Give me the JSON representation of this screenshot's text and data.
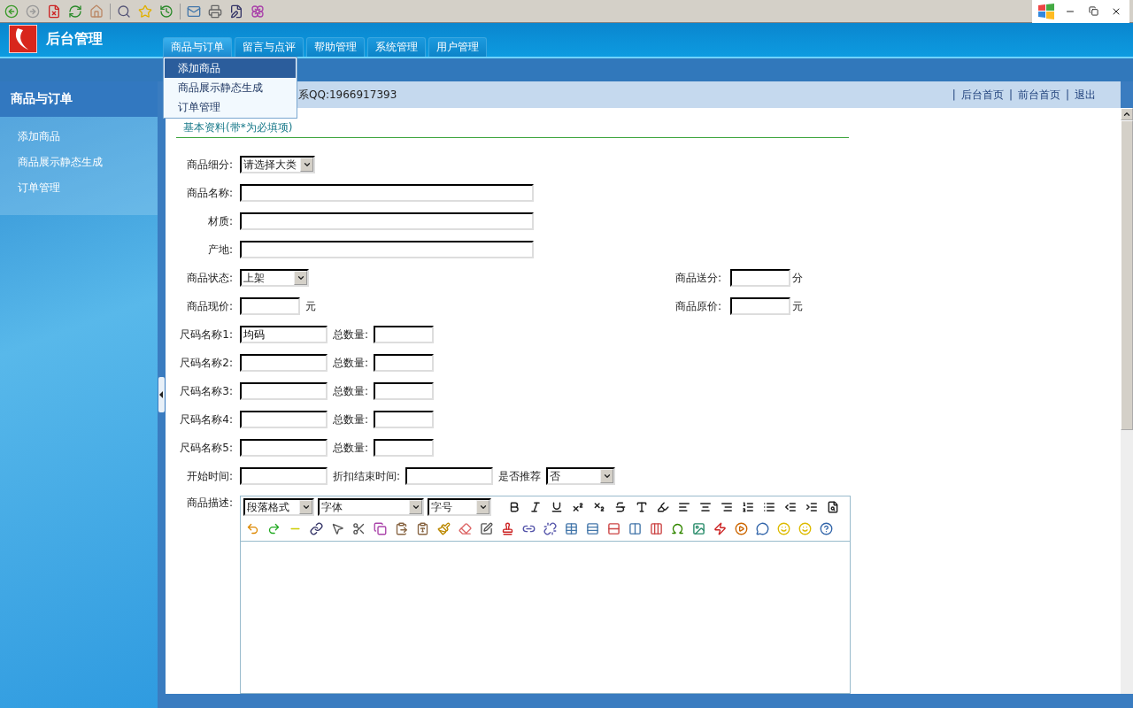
{
  "header": {
    "title": "后台管理",
    "tabs": [
      {
        "label": "商品与订单",
        "selected": true
      },
      {
        "label": "留言与点评",
        "selected": false
      },
      {
        "label": "帮助管理",
        "selected": false
      },
      {
        "label": "系统管理",
        "selected": false
      },
      {
        "label": "用户管理",
        "selected": false
      }
    ],
    "dropdown": [
      {
        "label": "添加商品",
        "selected": true
      },
      {
        "label": "商品展示静态生成",
        "selected": false
      },
      {
        "label": "订单管理",
        "selected": false
      }
    ]
  },
  "sidebar": {
    "title": "商品与订单",
    "items": [
      "添加商品",
      "商品展示静态生成",
      "订单管理"
    ]
  },
  "info_bar": {
    "text": "系QQ:1966917393",
    "links": [
      {
        "separator": "|",
        "label": "后台首页"
      },
      {
        "separator": "|",
        "label": "前台首页"
      },
      {
        "separator": "|",
        "label": "退出"
      }
    ]
  },
  "form": {
    "heading": "基本资料(带*为必填项)",
    "rows": [
      {
        "label": "商品细分:",
        "items": [
          {
            "kind": "select",
            "value": "请选择大类"
          }
        ]
      },
      {
        "label": "商品名称:",
        "items": [
          {
            "kind": "wide_input"
          }
        ]
      },
      {
        "label": "材质:",
        "items": [
          {
            "kind": "wide_input"
          }
        ]
      },
      {
        "label": "产地:",
        "items": [
          {
            "kind": "wide_input"
          }
        ]
      },
      {
        "label": "商品状态:",
        "items": [
          {
            "kind": "select",
            "value": "上架"
          }
        ],
        "aside": {
          "label": "商品送分:",
          "items": [
            {
              "kind": "small_input"
            },
            {
              "kind": "text",
              "text": "分"
            }
          ]
        }
      },
      {
        "label": "商品现价:",
        "items": [
          {
            "kind": "small_input"
          },
          {
            "kind": "text",
            "text": "元"
          }
        ],
        "aside": {
          "label": "商品原价:",
          "items": [
            {
              "kind": "small_input"
            },
            {
              "kind": "text",
              "text": "元"
            }
          ]
        }
      },
      {
        "label": "尺码名称1:",
        "items": [
          {
            "kind": "short_input",
            "value": "均码"
          },
          {
            "kind": "text",
            "text": "总数量:"
          },
          {
            "kind": "small_input"
          }
        ]
      },
      {
        "label": "尺码名称2:",
        "items": [
          {
            "kind": "short_input"
          },
          {
            "kind": "text",
            "text": "总数量:"
          },
          {
            "kind": "small_input"
          }
        ]
      },
      {
        "label": "尺码名称3:",
        "items": [
          {
            "kind": "short_input"
          },
          {
            "kind": "text",
            "text": "总数量:"
          },
          {
            "kind": "small_input"
          }
        ]
      },
      {
        "label": "尺码名称4:",
        "items": [
          {
            "kind": "short_input"
          },
          {
            "kind": "text",
            "text": "总数量:"
          },
          {
            "kind": "small_input"
          }
        ]
      },
      {
        "label": "尺码名称5:",
        "items": [
          {
            "kind": "short_input"
          },
          {
            "kind": "text",
            "text": "总数量:"
          },
          {
            "kind": "small_input"
          }
        ]
      },
      {
        "label": "开始时间:",
        "items": [
          {
            "kind": "short_input"
          },
          {
            "kind": "text",
            "text": "折扣结束时间:"
          },
          {
            "kind": "short_input"
          },
          {
            "kind": "text",
            "text": "是否推荐"
          },
          {
            "kind": "select",
            "value": "否"
          }
        ]
      }
    ],
    "editor": {
      "label": "商品描述:",
      "selects": [
        "段落格式",
        "字体",
        "字号"
      ]
    }
  }
}
